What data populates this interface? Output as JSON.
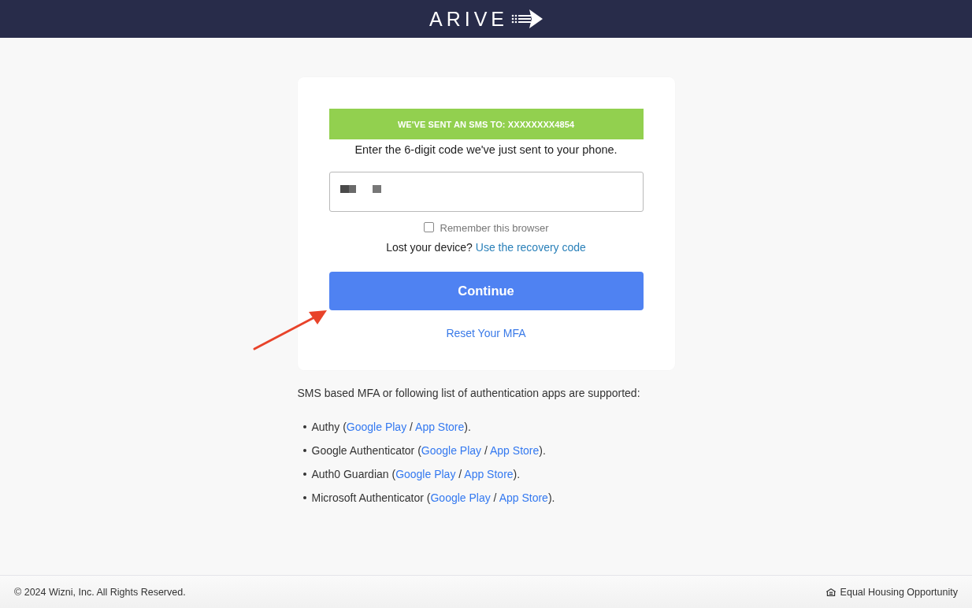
{
  "header": {
    "logo": "ARIVE"
  },
  "mfa_card": {
    "banner": "WE'VE SENT AN SMS TO: XXXXXXXX4854",
    "instruction": "Enter the 6-digit code we've just sent to your phone.",
    "code_field": {
      "redacted": true
    },
    "remember_browser": {
      "label": "Remember this browser",
      "checked": false
    },
    "lost_device": [
      {
        "kind": "text",
        "text": "Lost your device? "
      },
      {
        "kind": "link",
        "text": "Use the recovery code"
      }
    ],
    "continue_button": "Continue",
    "reset_link": "Reset Your MFA"
  },
  "supported_apps": {
    "intro": "SMS based MFA or following list of authentication apps are supported:",
    "apps": [
      {
        "parts": [
          {
            "kind": "text",
            "text": "Authy ("
          },
          {
            "kind": "link",
            "text": "Google Play"
          },
          {
            "kind": "text",
            "text": " / "
          },
          {
            "kind": "link",
            "text": "App Store"
          },
          {
            "kind": "text",
            "text": ")."
          }
        ]
      },
      {
        "parts": [
          {
            "kind": "text",
            "text": "Google Authenticator ("
          },
          {
            "kind": "link",
            "text": "Google Play"
          },
          {
            "kind": "text",
            "text": " / "
          },
          {
            "kind": "link",
            "text": "App Store"
          },
          {
            "kind": "text",
            "text": ")."
          }
        ]
      },
      {
        "parts": [
          {
            "kind": "text",
            "text": "Auth0 Guardian ("
          },
          {
            "kind": "link",
            "text": "Google Play"
          },
          {
            "kind": "text",
            "text": " / "
          },
          {
            "kind": "link",
            "text": "App Store"
          },
          {
            "kind": "text",
            "text": ")."
          }
        ]
      },
      {
        "parts": [
          {
            "kind": "text",
            "text": "Microsoft Authenticator ("
          },
          {
            "kind": "link",
            "text": "Google Play"
          },
          {
            "kind": "text",
            "text": " / "
          },
          {
            "kind": "link",
            "text": "App Store"
          },
          {
            "kind": "text",
            "text": ")."
          }
        ]
      }
    ]
  },
  "footer": {
    "copyright": "© 2024 Wizni, Inc. All Rights Reserved.",
    "equal_housing": "Equal Housing Opportunity"
  }
}
